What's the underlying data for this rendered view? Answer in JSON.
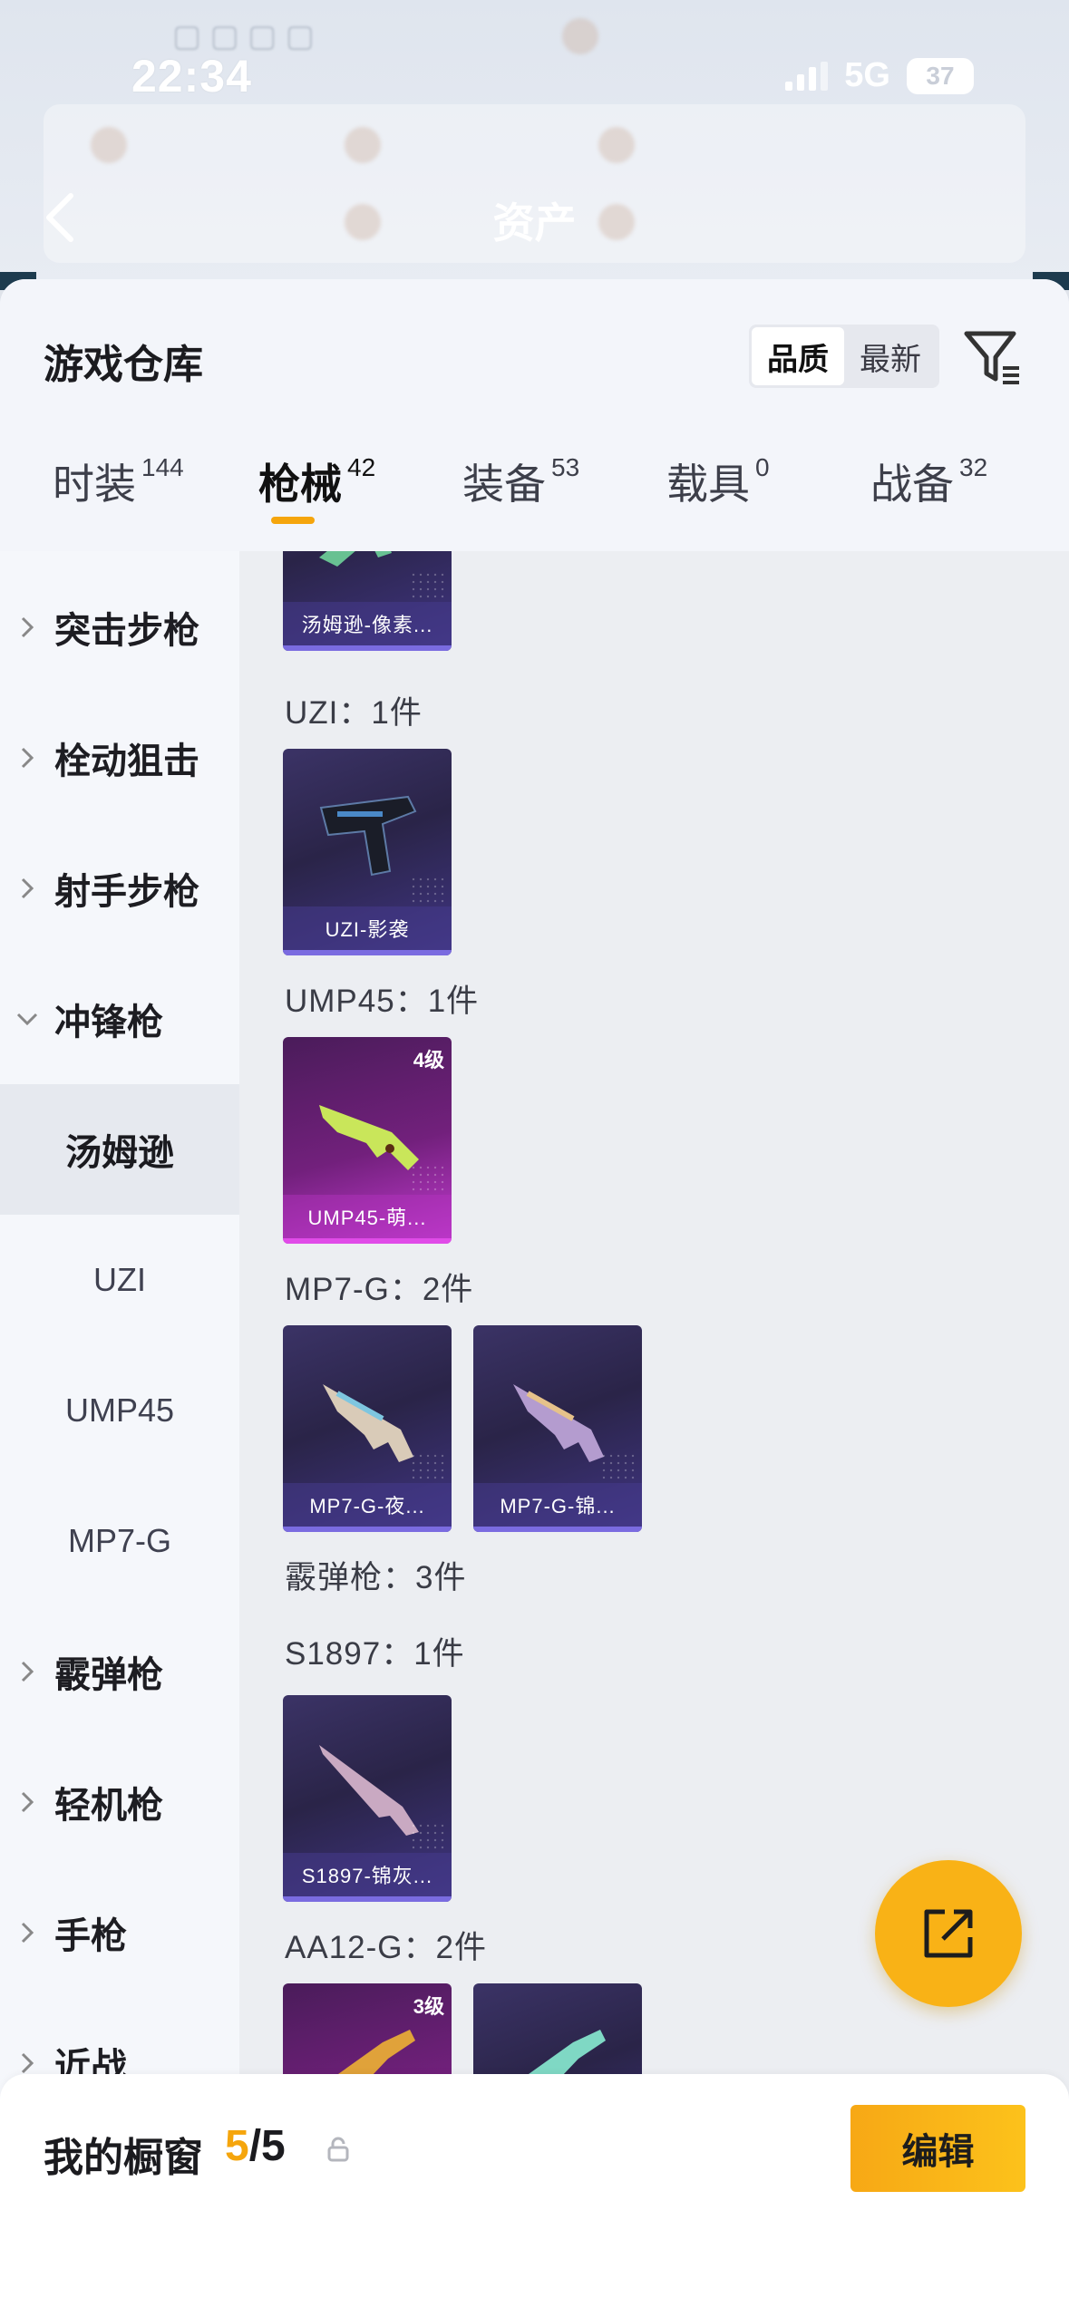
{
  "status_bar": {
    "time": "22:34",
    "network": "5G",
    "battery": "37"
  },
  "nav": {
    "title": "资产"
  },
  "sheet": {
    "title": "游戏仓库",
    "sort": {
      "options": [
        "品质",
        "最新"
      ],
      "selected": "品质"
    }
  },
  "tabs": [
    {
      "label": "时装",
      "count": "144"
    },
    {
      "label": "枪械",
      "count": "42",
      "active": true
    },
    {
      "label": "装备",
      "count": "53"
    },
    {
      "label": "载具",
      "count": "0"
    },
    {
      "label": "战备",
      "count": "32"
    }
  ],
  "sidebar": {
    "categories": [
      {
        "label": "突击步枪",
        "expanded": false
      },
      {
        "label": "栓动狙击",
        "expanded": false
      },
      {
        "label": "射手步枪",
        "expanded": false
      },
      {
        "label": "冲锋枪",
        "expanded": true
      },
      {
        "label": "霰弹枪",
        "expanded": false
      },
      {
        "label": "轻机枪",
        "expanded": false
      },
      {
        "label": "手枪",
        "expanded": false
      },
      {
        "label": "近战",
        "expanded": false
      }
    ],
    "subcategories": [
      "汤姆逊",
      "UZI",
      "UMP45",
      "MP7-G"
    ],
    "active_sub": "汤姆逊"
  },
  "content": {
    "groups": [
      {
        "title": "",
        "items": [
          {
            "name": "汤姆逊-像素...",
            "level": ""
          }
        ]
      },
      {
        "title": "UZI：1件",
        "items": [
          {
            "name": "UZI-影袭",
            "level": ""
          }
        ]
      },
      {
        "title": "UMP45：1件",
        "items": [
          {
            "name": "UMP45-萌...",
            "level": "4级"
          }
        ]
      },
      {
        "title": "MP7-G：2件",
        "items": [
          {
            "name": "MP7-G-夜...",
            "level": ""
          },
          {
            "name": "MP7-G-锦...",
            "level": ""
          }
        ]
      },
      {
        "title": "霰弹枪：3件",
        "items": []
      },
      {
        "title": "S1897：1件",
        "items": [
          {
            "name": "S1897-锦灰...",
            "level": ""
          }
        ]
      },
      {
        "title": "AA12-G：2件",
        "items": [
          {
            "name": "",
            "level": "3级"
          },
          {
            "name": "",
            "level": ""
          }
        ]
      }
    ]
  },
  "showcase": {
    "label": "我的橱窗",
    "current": "5",
    "separator": "/",
    "max": "5",
    "edit_label": "编辑"
  },
  "colors": {
    "accent": "#f5a50c",
    "card_purple": "#3b3366",
    "card_pink": "#c33bd1",
    "fab": "#f9b216"
  }
}
